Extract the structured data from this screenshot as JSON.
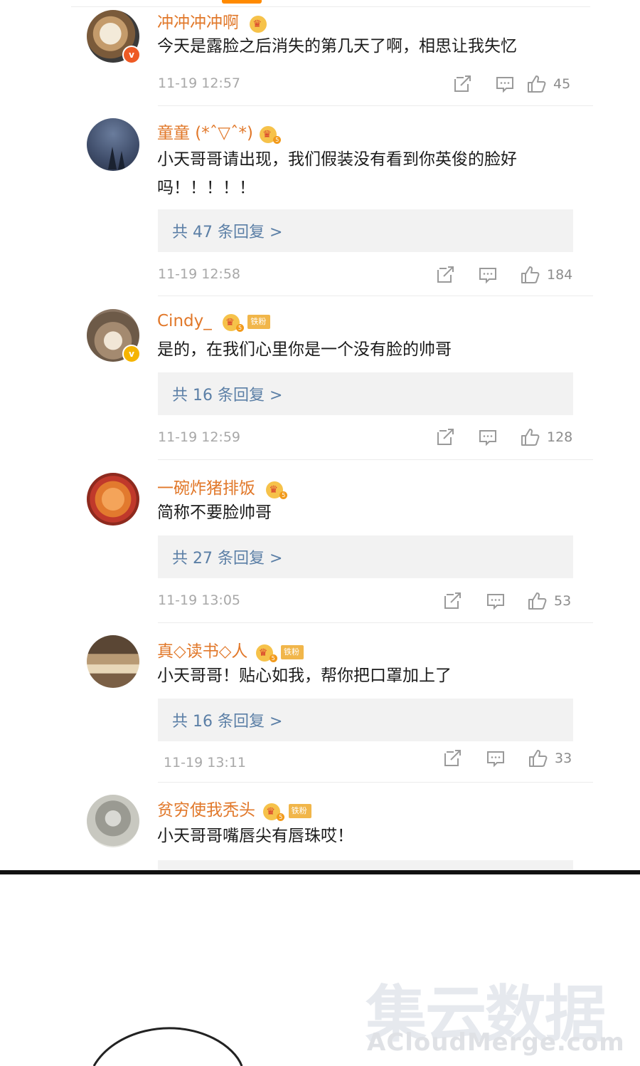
{
  "comments": [
    {
      "name": "冲冲冲冲啊",
      "text": "今天是露脸之后消失的第几天了啊，相思让我失忆",
      "time": "11-19  12:57",
      "likes": "45",
      "verified": "v",
      "fan_tag": ""
    },
    {
      "name": "童童 (*ˆ▽ˆ*)",
      "text": "小天哥哥请出现，我们假装没有看到你英俊的脸好吗！！！！！",
      "replies": "共 47 条回复 >",
      "time": "11-19 12:58",
      "likes": "184",
      "fan_tag": ""
    },
    {
      "name": "Cindy_",
      "text": "是的，在我们心里你是一个没有脸的帅哥",
      "replies": "共 16 条回复 >",
      "time": "11-19 12:59",
      "likes": "128",
      "verified": "v",
      "fan_tag": "铁粉"
    },
    {
      "name": "一碗炸猪排饭",
      "text": "简称不要脸帅哥",
      "replies": "共 27 条回复 >",
      "time": "11-19 13:05",
      "likes": "53",
      "fan_tag": ""
    },
    {
      "name": "真◇读书◇人",
      "text": "小天哥哥！贴心如我，帮你把口罩加上了",
      "replies": "共 16 条回复 >",
      "time": "11-19 13:11",
      "likes": "33",
      "fan_tag": "铁粉"
    },
    {
      "name": "贫穷使我秃头",
      "text": "小天哥哥嘴唇尖有唇珠哎！",
      "fan_tag": "铁粉"
    }
  ],
  "crown_level": "5",
  "watermark": {
    "cn": "集云数据",
    "en": "ACloudMerge.com"
  },
  "colors": {
    "name": "#e1782a",
    "reply_link": "#5b7fa6",
    "accent": "#ff8a00"
  },
  "icons": [
    "share-icon",
    "comment-icon",
    "like-icon",
    "crown-icon",
    "verified-icon"
  ]
}
